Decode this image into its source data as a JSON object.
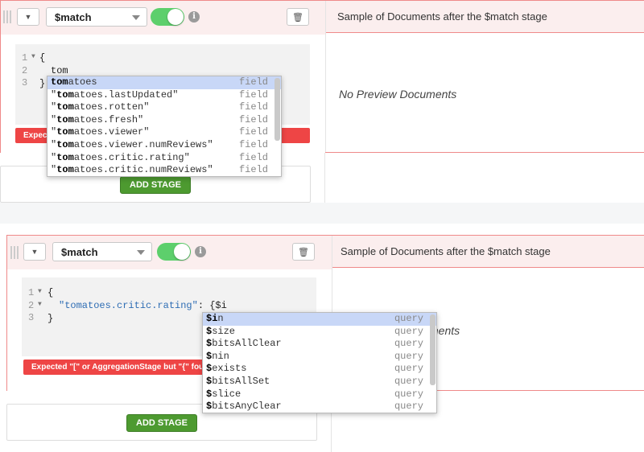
{
  "top": {
    "operator": "$match",
    "preview_title": "Sample of Documents after the $match stage",
    "no_preview": "No Preview Documents",
    "lines": [
      "1",
      "2",
      "3"
    ],
    "code": [
      "{",
      "tom",
      "}"
    ],
    "error_prefix": "Expect",
    "add_stage": "ADD STAGE",
    "autocomplete": [
      {
        "bold": "tom",
        "rest": "atoes",
        "pre": "",
        "post": "",
        "meta": "field"
      },
      {
        "bold": "tom",
        "rest": "atoes.lastUpdated",
        "pre": "\"",
        "post": "\"",
        "meta": "field"
      },
      {
        "bold": "tom",
        "rest": "atoes.rotten",
        "pre": "\"",
        "post": "\"",
        "meta": "field"
      },
      {
        "bold": "tom",
        "rest": "atoes.fresh",
        "pre": "\"",
        "post": "\"",
        "meta": "field"
      },
      {
        "bold": "tom",
        "rest": "atoes.viewer",
        "pre": "\"",
        "post": "\"",
        "meta": "field"
      },
      {
        "bold": "tom",
        "rest": "atoes.viewer.numReviews",
        "pre": "\"",
        "post": "\"",
        "meta": "field"
      },
      {
        "bold": "tom",
        "rest": "atoes.critic.rating",
        "pre": "\"",
        "post": "\"",
        "meta": "field"
      },
      {
        "bold": "tom",
        "rest": "atoes.critic.numReviews",
        "pre": "\"",
        "post": "\"",
        "meta": "field"
      }
    ]
  },
  "bottom": {
    "operator": "$match",
    "preview_title": "Sample of Documents after the $match stage",
    "preview_fragment": "ments",
    "lines": [
      "1",
      "2",
      "3"
    ],
    "code_open": "{",
    "code_key": "\"tomatoes.critic.rating\"",
    "code_rest": ": {$i",
    "code_close": "}",
    "error": "Expected \"[\" or AggregationStage but \"{\" foun",
    "add_stage": "ADD STAGE",
    "autocomplete": [
      {
        "bold": "$i",
        "rest": "n",
        "meta": "query"
      },
      {
        "bold": "$",
        "rest": "size",
        "meta": "query"
      },
      {
        "bold": "$",
        "rest": "bitsAllClear",
        "meta": "query"
      },
      {
        "bold": "$",
        "rest": "nin",
        "meta": "query"
      },
      {
        "bold": "$",
        "rest": "exists",
        "meta": "query"
      },
      {
        "bold": "$",
        "rest": "bitsAllSet",
        "meta": "query"
      },
      {
        "bold": "$",
        "rest": "slice",
        "meta": "query"
      },
      {
        "bold": "$",
        "rest": "bitsAnyClear",
        "meta": "query"
      }
    ]
  }
}
